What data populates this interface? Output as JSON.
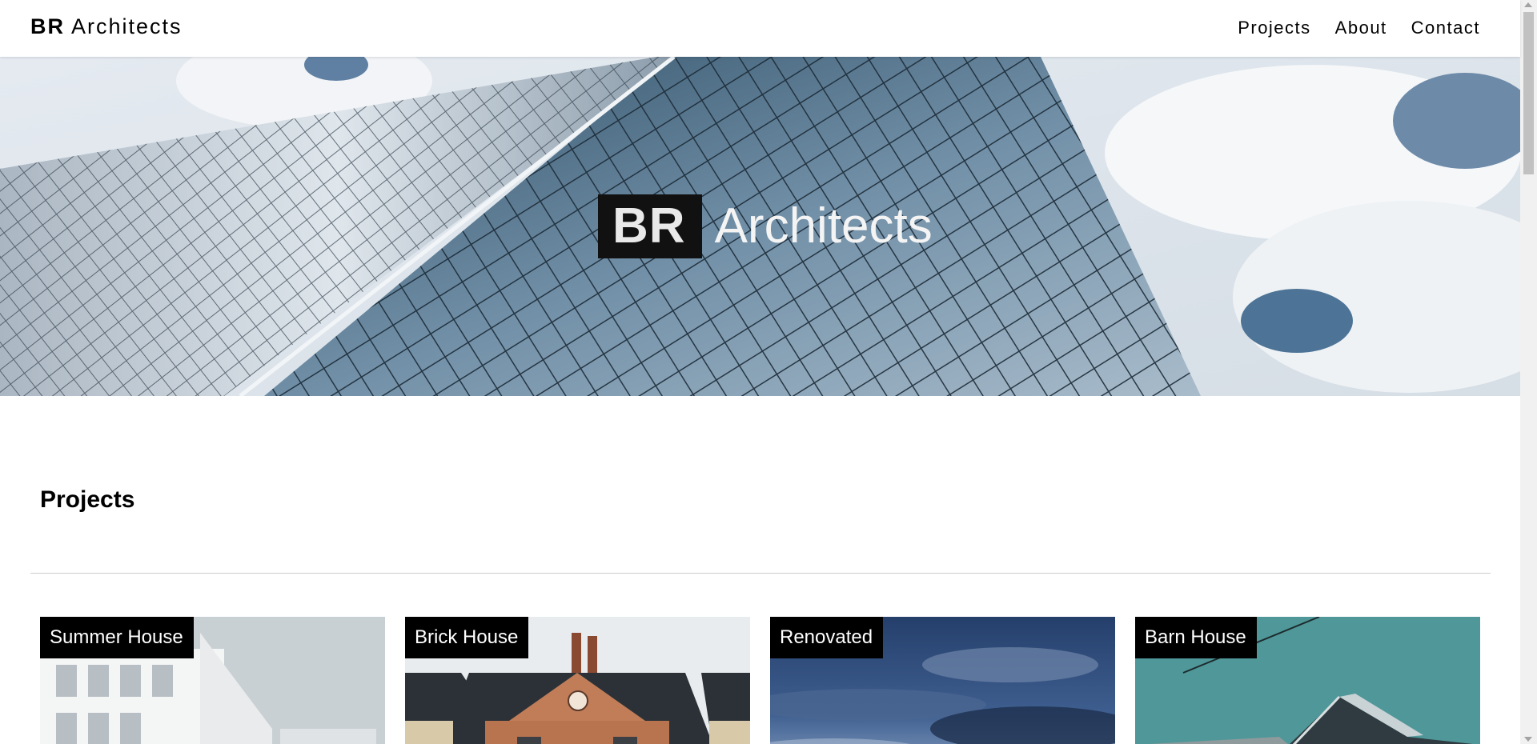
{
  "header": {
    "brand_bold": "BR",
    "brand_rest": " Architects",
    "nav": [
      {
        "label": "Projects"
      },
      {
        "label": "About"
      },
      {
        "label": "Contact"
      }
    ]
  },
  "hero": {
    "title_bold": "BR",
    "title_rest": "Architects",
    "image": "glass-skyscraper-against-clouds"
  },
  "projects": {
    "heading": "Projects",
    "cards": [
      {
        "label": "Summer House",
        "image": "white-modern-building"
      },
      {
        "label": "Brick House",
        "image": "brick-house-with-chimneys"
      },
      {
        "label": "Renovated",
        "image": "dusk-sky-clouds"
      },
      {
        "label": "Barn House",
        "image": "barn-house-teal-sky"
      }
    ]
  },
  "colors": {
    "text": "#000000",
    "label_bg": "#000000",
    "label_text": "#ffffff",
    "divider": "#cccccc"
  }
}
